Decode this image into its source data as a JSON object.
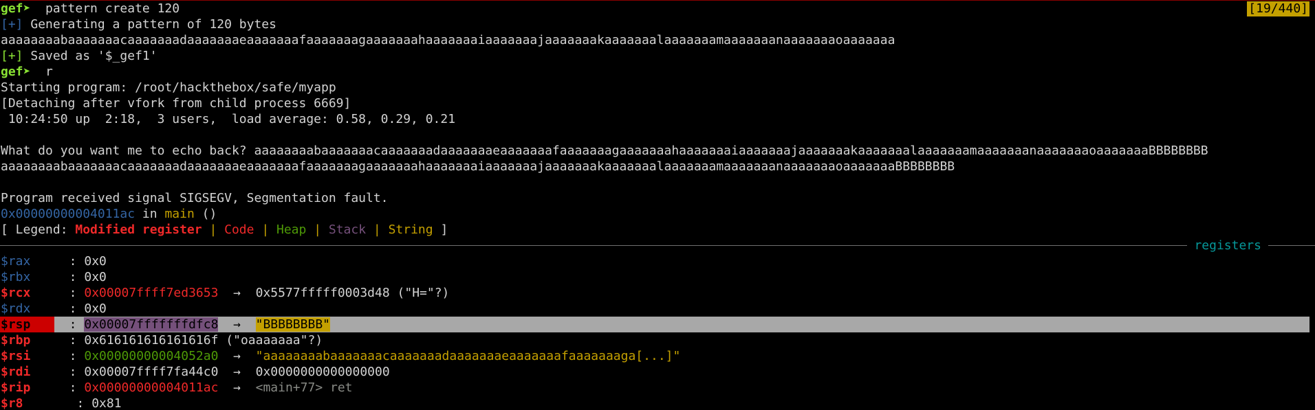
{
  "position_counter": "[19/440]",
  "prompt": "gef➤",
  "commands": {
    "pattern_cmd": "  pattern create 120",
    "run_cmd": "  r"
  },
  "info_prefix": "[+]",
  "generating_msg": " Generating a pattern of 120 bytes",
  "pattern": "aaaaaaaabaaaaaaacaaaaaaadaaaaaaaeaaaaaaafaaaaaaagaaaaaaahaaaaaaaiaaaaaaajaaaaaaakaaaaaaalaaaaaaamaaaaaaanaaaaaaaoaaaaaaa",
  "saved_msg": " Saved as '$_gef1'",
  "starting_program": "Starting program: /root/hackthebox/safe/myapp",
  "detaching_msg": "[Detaching after vfork from child process 6669]",
  "uptime_msg": " 10:24:50 up  2:18,  3 users,  load average: 0.58, 0.29, 0.21",
  "echo_prompt": "What do you want me to echo back? aaaaaaaabaaaaaaacaaaaaaadaaaaaaaeaaaaaaafaaaaaaagaaaaaaahaaaaaaaiaaaaaaajaaaaaaakaaaaaaalaaaaaaamaaaaaaanaaaaaaaoaaaaaaaBBBBBBBB",
  "echo_output": "aaaaaaaabaaaaaaacaaaaaaadaaaaaaaeaaaaaaafaaaaaaagaaaaaaahaaaaaaaiaaaaaaajaaaaaaakaaaaaaalaaaaaaamaaaaaaanaaaaaaaoaaaaaaaBBBBBBBB",
  "signal_msg": "Program received signal SIGSEGV, Segmentation fault.",
  "fault_location": {
    "address": "0x00000000004011ac",
    "in_text": " in ",
    "func": "main",
    "args": " ()"
  },
  "legend": {
    "open": "[ Legend: ",
    "modified": "Modified register",
    "sep": " | ",
    "code": "Code",
    "heap": "Heap",
    "stack": "Stack",
    "string": "String",
    "close": " ]"
  },
  "section_label": "registers",
  "registers": [
    {
      "name": "$rax",
      "sep": "  : ",
      "value": "0x0",
      "arrow": "",
      "target": "",
      "extra": ""
    },
    {
      "name": "$rbx",
      "sep": "  : ",
      "value": "0x0",
      "arrow": "",
      "target": "",
      "extra": ""
    },
    {
      "name": "$rcx",
      "sep": "  : ",
      "value": "0x00007ffff7ed3653",
      "arrow": "  →  ",
      "target": "0x5577fffff0003d48",
      "extra": " (\"H=\"?)"
    },
    {
      "name": "$rdx",
      "sep": "  : ",
      "value": "0x0",
      "arrow": "",
      "target": "",
      "extra": ""
    },
    {
      "name": "$rsp",
      "sep": "  : ",
      "value": "0x00007fffffffdfc8",
      "arrow": "  →  ",
      "target": "\"BBBBBBBB\"",
      "extra": ""
    },
    {
      "name": "$rbp",
      "sep": "  : ",
      "value": "0x616161616161616f",
      "arrow": "",
      "target": "",
      "extra": " (\"oaaaaaaa\"?)"
    },
    {
      "name": "$rsi",
      "sep": "  : ",
      "value": "0x00000000004052a0",
      "arrow": "  →  ",
      "target": "\"aaaaaaaabaaaaaaacaaaaaaadaaaaaaaeaaaaaaafaaaaaaaga[...]\"",
      "extra": ""
    },
    {
      "name": "$rdi",
      "sep": "  : ",
      "value": "0x00007ffff7fa44c0",
      "arrow": "  →  ",
      "target": "0x0000000000000000",
      "extra": ""
    },
    {
      "name": "$rip",
      "sep": "  : ",
      "value": "0x00000000004011ac",
      "arrow": "  →  ",
      "target": "<main+77> ret",
      "extra": ""
    },
    {
      "name": "$r8",
      "sep": "   : ",
      "value": "0x81",
      "arrow": "",
      "target": "",
      "extra": ""
    }
  ],
  "colors": {
    "background": "#000000",
    "foreground": "#d3d3d3",
    "prompt": "#8ae234",
    "modified_register": "#ef2929",
    "code": "#ef2929",
    "heap": "#4e9a06",
    "stack": "#75507b",
    "string": "#c4a000",
    "info": "#3465a4",
    "section": "#06989a"
  }
}
